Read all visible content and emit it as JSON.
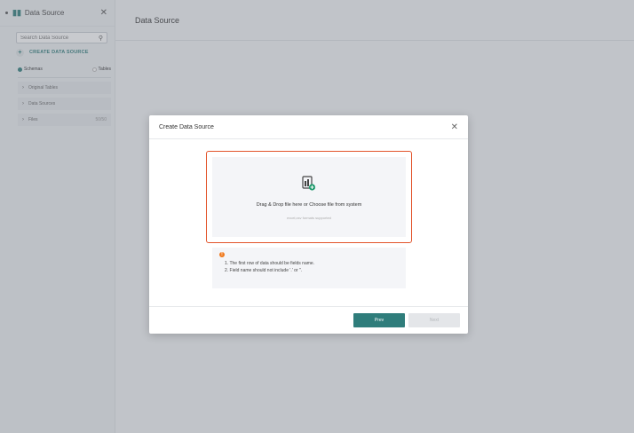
{
  "sidebar": {
    "title": "Data Source",
    "search_placeholder": "Search Data Source",
    "create_label": "CREATE DATA SOURCE",
    "radio_schemas": "Schemas",
    "radio_tables": "Tables",
    "items": [
      {
        "label": "Original Tables",
        "count": ""
      },
      {
        "label": "Data Sources",
        "count": ""
      },
      {
        "label": "Files",
        "count": "50/50"
      }
    ]
  },
  "main": {
    "title": "Data Source"
  },
  "modal": {
    "title": "Create Data Source",
    "drop_text": "Drag & Drop file here or Choose file from system",
    "drop_hint": "excel,csv formats supported",
    "note_1": "1. The first row of data should be fields name.",
    "note_2": "2. Field name should not include '.' or ''.",
    "prev_label": "Prev",
    "next_label": "Next"
  },
  "colors": {
    "accent": "#2f7d7b",
    "highlight": "#e2532a",
    "warning": "#f07a1e"
  },
  "icons": [
    "bar-chart-icon",
    "close-icon",
    "search-icon",
    "plus-icon",
    "chevron-right-icon",
    "file-upload-icon",
    "warning-icon"
  ]
}
